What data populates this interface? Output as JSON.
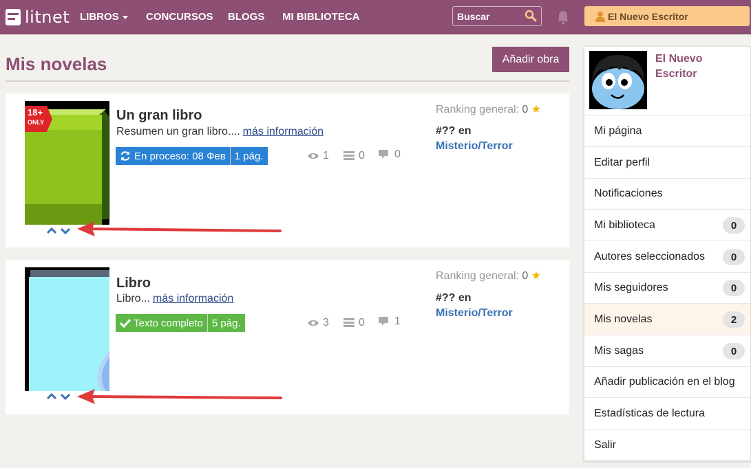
{
  "nav": {
    "logo_text": "litnet",
    "links": [
      "LIBROS",
      "CONCURSOS",
      "BLOGS",
      "MI BIBLIOTECA"
    ],
    "search_placeholder": "Buscar",
    "user_label": "El Nuevo Escritor",
    "colors": {
      "primary": "#8d4f73",
      "user_button": "#fbc98a"
    },
    "icons": [
      "logo-icon",
      "search-icon",
      "bell-icon",
      "user-icon"
    ]
  },
  "main": {
    "title": "Mis novelas",
    "add_button": "Añadir obra",
    "books": [
      {
        "title": "Un gran libro",
        "summary": "Resumen un gran libro....",
        "more_link": "más información",
        "status": "En proceso: 08 Фев",
        "pages": "1 pág.",
        "status_color": "#2a82d4",
        "views": "1",
        "library": "0",
        "comments": "0",
        "ranking_label": "Ranking general:",
        "ranking_value": "0",
        "position": "#?? en",
        "genre": "Misterio/Terror",
        "age_badge_top": "18+",
        "age_badge_bottom": "ONLY"
      },
      {
        "title": "Libro",
        "summary": "Libro...",
        "more_link": "más información",
        "status": "Texto completo",
        "pages": "5 pág.",
        "status_color": "#5db845",
        "views": "3",
        "library": "0",
        "comments": "1",
        "ranking_label": "Ranking general:",
        "ranking_value": "0",
        "position": "#?? en",
        "genre": "Misterio/Terror"
      }
    ]
  },
  "sidebar": {
    "profile_name": "El Nuevo Escritor",
    "items": [
      {
        "label": "Mi página"
      },
      {
        "label": "Editar perfil"
      },
      {
        "label": "Notificaciones"
      },
      {
        "label": "Mi biblioteca",
        "count": "0"
      },
      {
        "label": "Autores seleccionados",
        "count": "0"
      },
      {
        "label": "Mis seguidores",
        "count": "0"
      },
      {
        "label": "Mis novelas",
        "count": "2",
        "active": true
      },
      {
        "label": "Mis sagas",
        "count": "0"
      },
      {
        "label": "Añadir publicación en el blog"
      },
      {
        "label": "Estadísticas de lectura"
      },
      {
        "label": "Salir"
      }
    ]
  }
}
